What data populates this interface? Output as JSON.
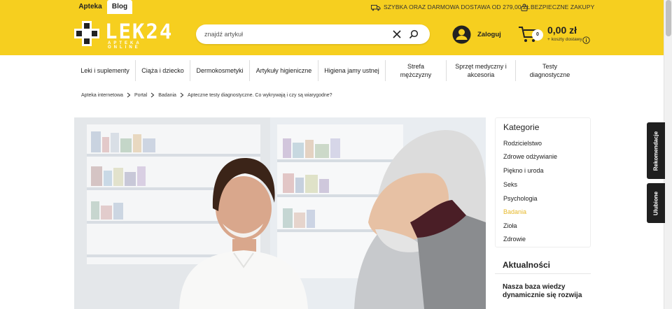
{
  "top_tabs": {
    "pharmacy": "Apteka",
    "blog": "Blog"
  },
  "promos": {
    "delivery": "SZYBKA ORAZ DARMOWA DOSTAWA OD 279,00 ZŁ",
    "secure": "BEZPIECZNE ZAKUPY"
  },
  "logo": {
    "text": "LEK24",
    "subtitle": "APTEKA ONLINE"
  },
  "search": {
    "placeholder": "znajdź artykuł"
  },
  "account": {
    "login_label": "Zaloguj"
  },
  "cart": {
    "count": "0",
    "price": "0,00 zł",
    "shipping_note": "+ koszty dostawy"
  },
  "categories": [
    "Leki i suplementy",
    "Ciąża i dziecko",
    "Dermokosmetyki",
    "Artykuły higieniczne",
    "Higiena jamy ustnej",
    "Strefa mężczyzny",
    "Sprzęt medyczny i akcesoria",
    "Testy diagnostyczne"
  ],
  "breadcrumb": [
    "Apteka internetowa",
    "Portal",
    "Badania",
    "Apteczne testy diagnostyczne. Co wykrywają i czy są wiarygodne?"
  ],
  "sidebar": {
    "title": "Kategorie",
    "links": [
      "Rodzicielstwo",
      "Zdrowe odżywianie",
      "Piękno i uroda",
      "Seks",
      "Psychologia",
      "Badania",
      "Zioła",
      "Zdrowie"
    ],
    "active_link": "Badania"
  },
  "news": {
    "title": "Aktualności",
    "item": "Nasza baza wiedzy dynamicznie się rozwija"
  },
  "side_tabs": {
    "recommend": "Rekomendacje",
    "favorites": "Ulubione"
  },
  "colors": {
    "brand_yellow": "#f6cf1f",
    "active_link": "#e7b92c",
    "side_tab_bg": "#1f1f1f"
  }
}
